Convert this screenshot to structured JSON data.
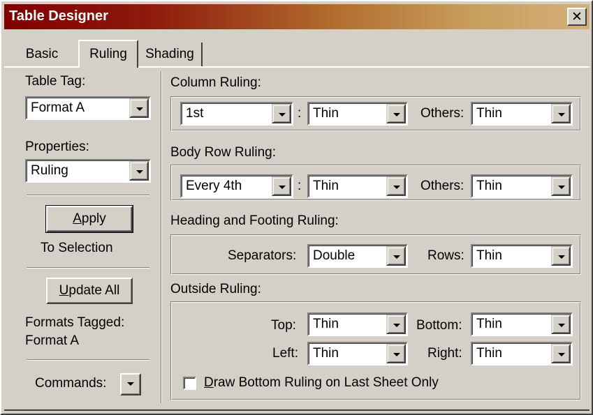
{
  "window": {
    "title": "Table Designer",
    "close_glyph": "✕"
  },
  "tabs": [
    {
      "label": "Basic",
      "active": false
    },
    {
      "label": "Ruling",
      "active": true
    },
    {
      "label": "Shading",
      "active": false
    }
  ],
  "left": {
    "table_tag_label": "Table Tag:",
    "table_tag_value": "Format A",
    "properties_label": "Properties:",
    "properties_value": "Ruling",
    "apply_button": "Apply",
    "apply_mnemonic": "A",
    "to_selection": "To Selection",
    "update_all_button": "Update All",
    "update_mnemonic": "U",
    "formats_tagged_label": "Formats Tagged:",
    "formats_tagged_value": "Format A",
    "commands_label": "Commands:"
  },
  "column_ruling": {
    "label": "Column Ruling:",
    "which": "1st",
    "weight": "Thin",
    "others_label": "Others:",
    "others_value": "Thin"
  },
  "body_row_ruling": {
    "label": "Body Row Ruling:",
    "which": "Every 4th",
    "weight": "Thin",
    "others_label": "Others:",
    "others_value": "Thin"
  },
  "heading_footing": {
    "label": "Heading and Footing Ruling:",
    "separators_label": "Separators:",
    "separators_value": "Double",
    "rows_label": "Rows:",
    "rows_value": "Thin"
  },
  "outside": {
    "label": "Outside Ruling:",
    "top_label": "Top:",
    "top_value": "Thin",
    "bottom_label": "Bottom:",
    "bottom_value": "Thin",
    "left_label": "Left:",
    "left_value": "Thin",
    "right_label": "Right:",
    "right_value": "Thin",
    "checkbox_label": "Draw Bottom Ruling on Last Sheet Only",
    "checkbox_mnemonic": "D",
    "checkbox_checked": false
  },
  "colon_separator": ":",
  "colors": {
    "title_start": "#800000",
    "title_end": "#d3b07a",
    "face": "#d4d0c8"
  }
}
